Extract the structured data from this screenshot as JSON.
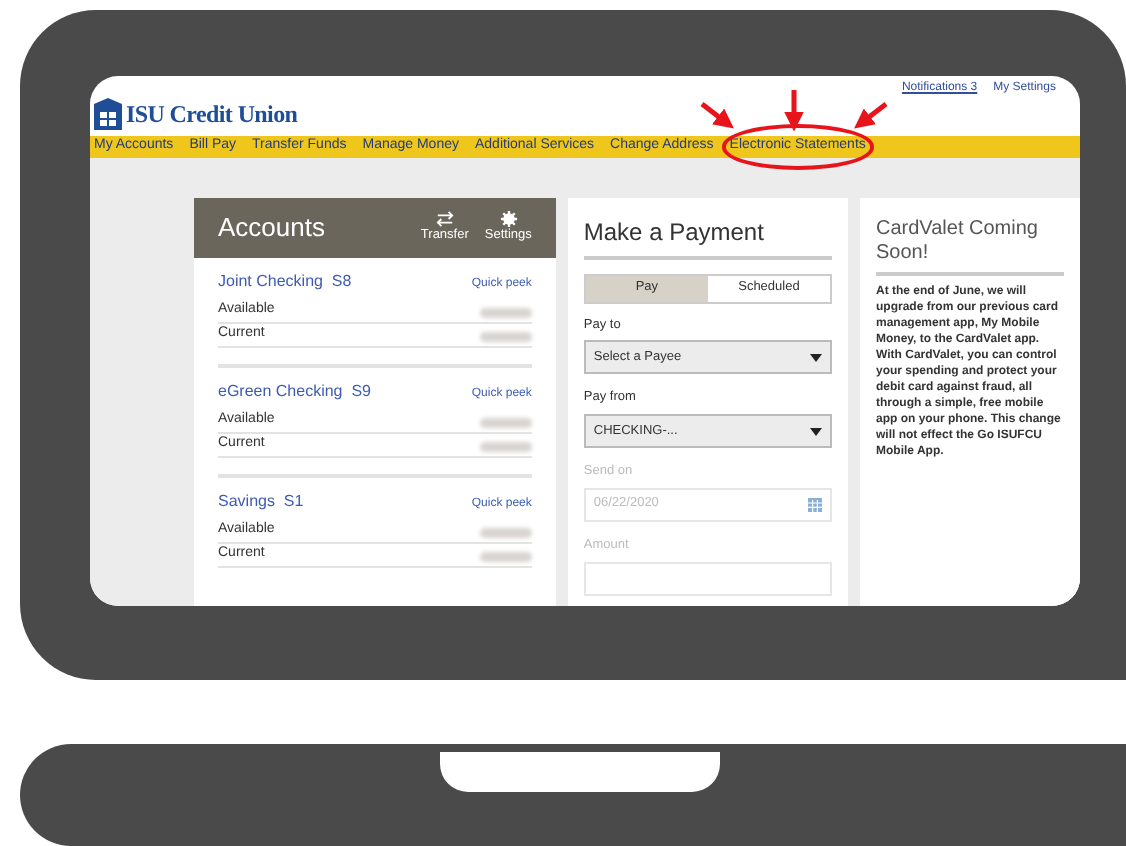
{
  "top_links": [
    {
      "label": "Notifications",
      "count": "3"
    },
    {
      "label": "My Settings"
    }
  ],
  "logo": {
    "text": "ISU Credit Union"
  },
  "nav": [
    {
      "label": "My Accounts",
      "highlighted": false
    },
    {
      "label": "Bill Pay",
      "highlighted": false
    },
    {
      "label": "Transfer Funds",
      "highlighted": false
    },
    {
      "label": "Manage Money",
      "highlighted": false
    },
    {
      "label": "Additional Services",
      "highlighted": false
    },
    {
      "label": "Change Address",
      "highlighted": false
    },
    {
      "label": "Electronic Statements",
      "highlighted": true
    }
  ],
  "accounts": {
    "title": "Accounts",
    "actions": [
      {
        "label": "Transfer",
        "kind": "transfer"
      },
      {
        "label": "Settings",
        "kind": "settings"
      }
    ],
    "items": [
      {
        "name": "Joint Checking  S8",
        "link": "Quick peek",
        "lines": [
          "Available",
          "Current"
        ]
      },
      {
        "name": "eGreen Checking  S9",
        "link": "Quick peek",
        "lines": [
          "Available",
          "Current"
        ]
      },
      {
        "name": "Savings  S1",
        "link": "Quick peek",
        "lines": [
          "Available",
          "Current"
        ]
      }
    ]
  },
  "payment": {
    "title": "Make a Payment",
    "tabs": [
      {
        "label": "Pay",
        "selected": true
      },
      {
        "label": "Scheduled",
        "selected": false
      }
    ],
    "fields": [
      {
        "label": "Pay to",
        "value": "Select a Payee",
        "kind": "select",
        "disabled": false
      },
      {
        "label": "Pay from",
        "value": "CHECKING-...",
        "kind": "select",
        "disabled": false
      },
      {
        "label": "Send on",
        "value": "06/22/2020",
        "kind": "date",
        "disabled": true
      },
      {
        "label": "Amount",
        "kind": "text",
        "disabled": true
      }
    ]
  },
  "news": {
    "title": "CardValet Coming Soon!",
    "body": "At the end of June, we will upgrade from our previous card management app, My Mobile Money, to the CardValet app. With CardValet, you can control your spending and protect your debit card against fraud, all through a simple, free mobile app on your phone. This change will not effect the Go ISUFCU Mobile App."
  }
}
